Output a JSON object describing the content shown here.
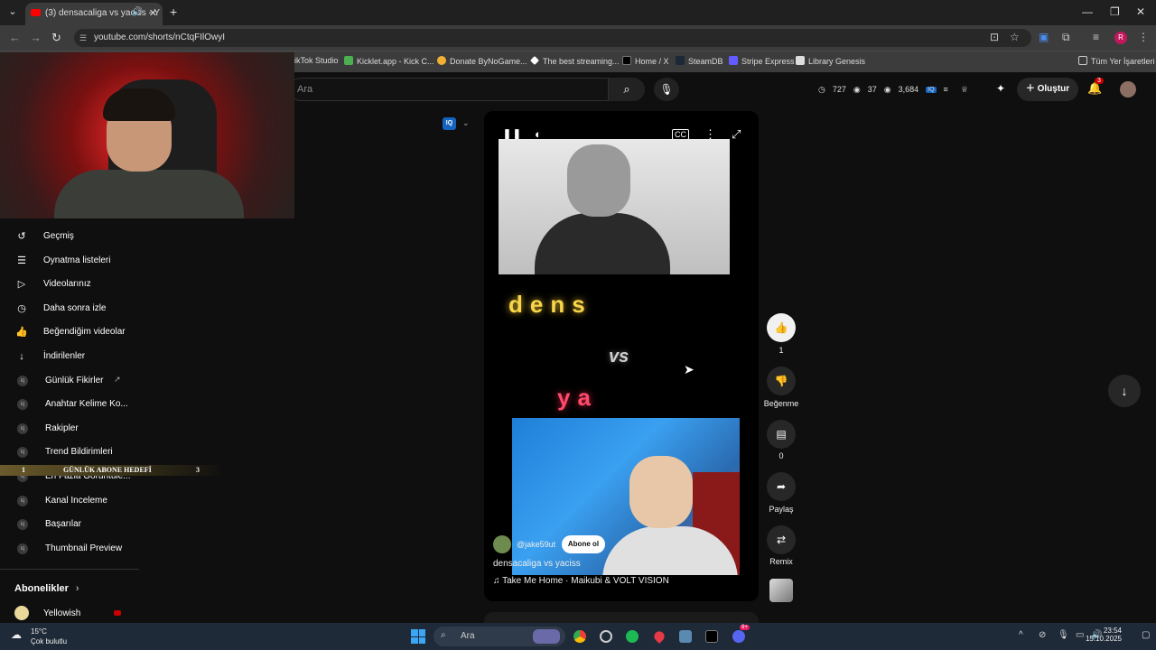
{
  "browser": {
    "tab_title": "(3) densacaliga vs yaciss - Y",
    "url": "youtube.com/shorts/nCtqFIlOwyI",
    "bookmarks": [
      "ikTok Studio",
      "Kicklet.app - Kick C...",
      "Donate ByNoGame...",
      "The best streaming...",
      "Home / X",
      "SteamDB",
      "Stripe Express",
      "Library Genesis"
    ],
    "all_bookmarks": "Tüm Yer İşaretleri",
    "profile_initial": "R"
  },
  "youtube": {
    "search_placeholder": "Ara",
    "stats": {
      "watch": "727",
      "views1": "37",
      "views2": "3,684"
    },
    "create_label": "Oluştur",
    "notif_count": "3"
  },
  "sidebar": {
    "items": [
      {
        "label": "Geçmiş",
        "icon": "history-icon"
      },
      {
        "label": "Oynatma listeleri",
        "icon": "playlist-icon"
      },
      {
        "label": "Videolarınız",
        "icon": "video-icon"
      },
      {
        "label": "Daha sonra izle",
        "icon": "clock-icon"
      },
      {
        "label": "Beğendiğim videolar",
        "icon": "thumbs-up-icon"
      },
      {
        "label": "İndirilenler",
        "icon": "download-icon"
      }
    ],
    "tools": [
      "Günlük Fikirler",
      "Anahtar Kelime Ko...",
      "Rakipler",
      "Trend Bildirimleri",
      "En Fazla Görüntüle...",
      "Kanal Inceleme",
      "Başarılar",
      "Thumbnail Preview"
    ],
    "goal_overlay": {
      "left_num": "1",
      "text": "GÜNLÜK ABONE HEDEFİ",
      "right_num": "3"
    },
    "subscriptions_title": "Abonelikler",
    "subscription_first": "Yellowish"
  },
  "short": {
    "overlay_word_1": "dens",
    "overlay_vs": "vs",
    "overlay_word_2": "ya",
    "channel_handle": "@jake59ut",
    "subscribe_label": "Abone ol",
    "title": "densacaliga vs yaciss",
    "music": "Take Me Home · Maikubi & VOLT VISION",
    "like_count": "1",
    "dislike_label": "Beğenme",
    "comment_count": "0",
    "share_label": "Paylaş",
    "remix_label": "Remix"
  },
  "taskbar": {
    "weather_temp": "15°C",
    "weather_desc": "Çok bulutlu",
    "search_label": "Ara",
    "time": "23:54",
    "date": "15.10.2025",
    "discord_badge": "9+"
  },
  "colors": {
    "accent_red": "#ff0000",
    "bg": "#0f0f0f",
    "taskbar": "#1e2a38"
  }
}
